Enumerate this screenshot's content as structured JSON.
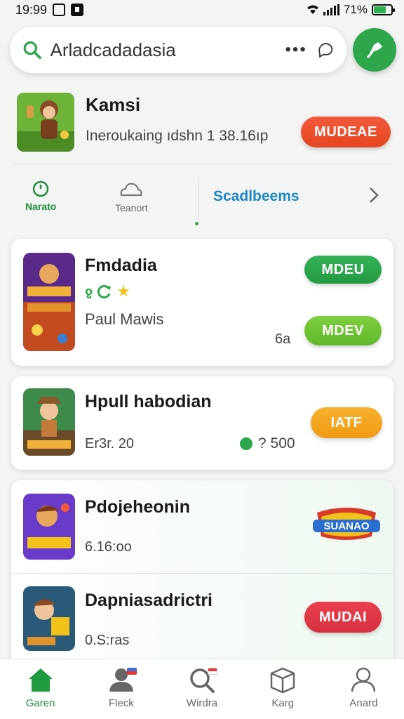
{
  "status_bar": {
    "time": "19:99",
    "battery_text": "71%",
    "battery_level": 0.71
  },
  "search": {
    "value": "Arladcadadasia"
  },
  "featured": {
    "title": "Kamsi",
    "subtitle": "Ineroukaing ıdshn 1 38.16ıp",
    "button_label": "MUDEAE"
  },
  "tabs": {
    "items": [
      {
        "label": "Narato",
        "icon": "clock-icon",
        "active": true
      },
      {
        "label": "Teanort",
        "icon": "cloud-icon",
        "active": false
      }
    ],
    "text_tab": "Scadlbeems"
  },
  "games": [
    {
      "title": "Fmdadia",
      "subtitle": "Paul Mawis",
      "meta": "6a",
      "button1": "MDEU",
      "button2": "MDEV"
    },
    {
      "title": "Hpull habodian",
      "subtitle": "Er3r. 20",
      "price": "? 500",
      "button": "IATF"
    },
    {
      "title": "Pdojeheonin",
      "subtitle": "6.16:oo",
      "logo_text": "SUANAO"
    },
    {
      "title": "Dapniasadrictri",
      "subtitle": "0.S:ras",
      "button": "MUDAI"
    }
  ],
  "bottom_nav": [
    {
      "label": "Garen",
      "icon": "home-icon",
      "active": true
    },
    {
      "label": "Fleck",
      "icon": "person-icon",
      "active": false
    },
    {
      "label": "Wirdra",
      "icon": "search-icon",
      "active": false
    },
    {
      "label": "Karg",
      "icon": "box-icon",
      "active": false
    },
    {
      "label": "Anard",
      "icon": "profile-icon",
      "active": false
    }
  ],
  "colors": {
    "accent_green": "#2ea64b",
    "red_button": "#e5451f",
    "orange_button": "#f5a21f",
    "blue_tab": "#1d86c9"
  }
}
